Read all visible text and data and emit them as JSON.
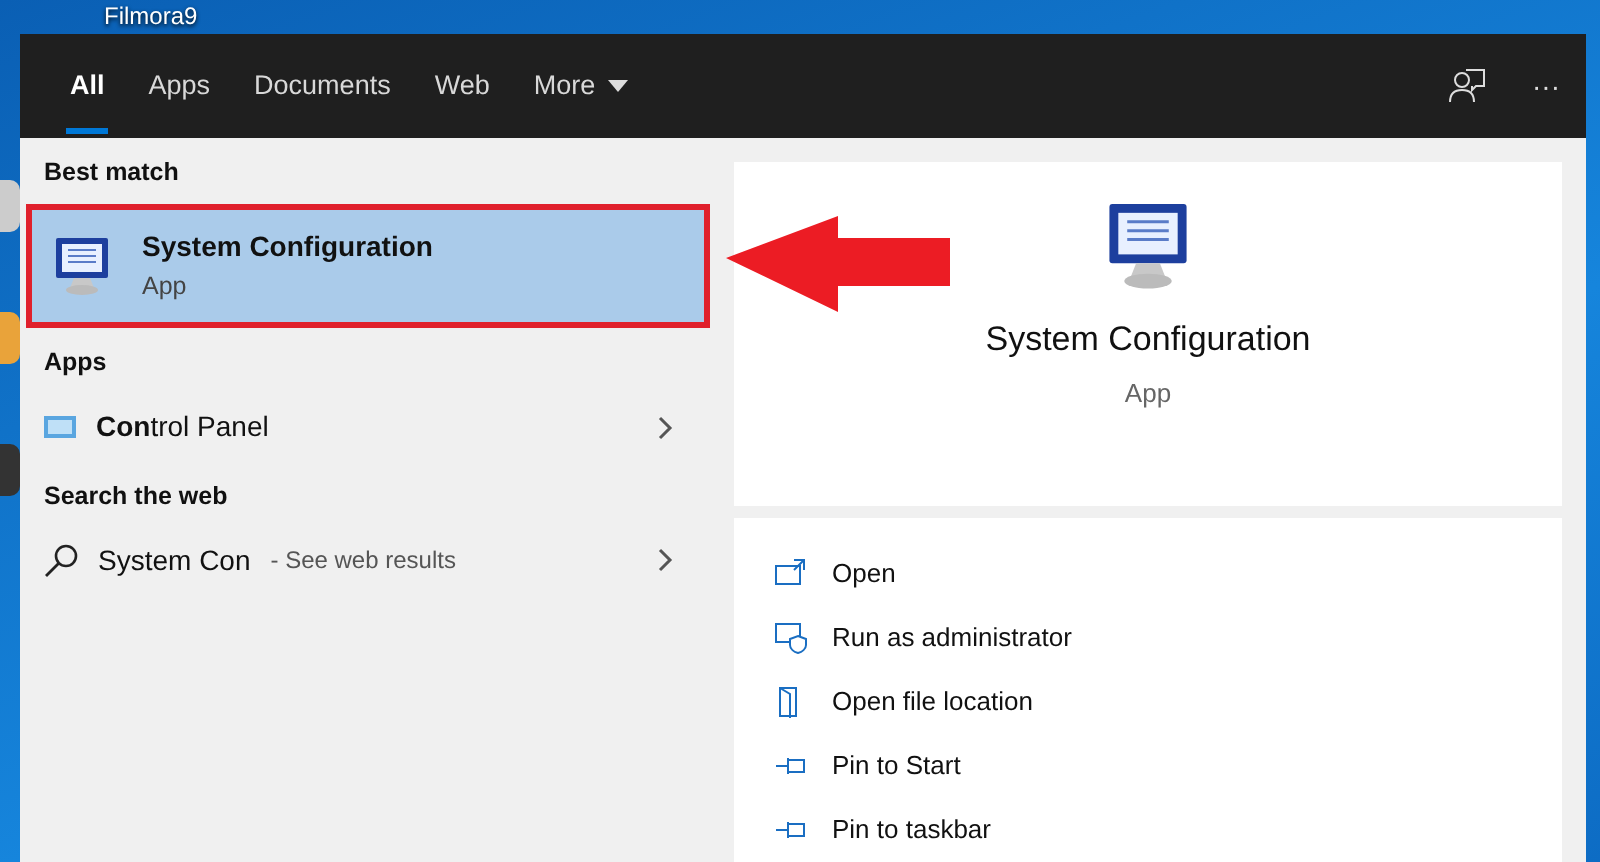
{
  "desktop": {
    "icon_label": "Filmora9"
  },
  "tabs": [
    {
      "label": "All",
      "selected": true
    },
    {
      "label": "Apps",
      "selected": false
    },
    {
      "label": "Documents",
      "selected": false
    },
    {
      "label": "Web",
      "selected": false
    },
    {
      "label": "More",
      "selected": false,
      "dropdown": true
    }
  ],
  "header_actions": [
    {
      "kind": "feedback"
    },
    {
      "kind": "more",
      "label": "···"
    }
  ],
  "sections": [
    {
      "heading": "Best match",
      "items": [
        {
          "kind": "best",
          "title": "System Configuration",
          "subtitle": "App",
          "selected": true,
          "highlighted": true
        }
      ]
    },
    {
      "heading": "Apps",
      "items": [
        {
          "kind": "app",
          "title": "**Con**trol Panel",
          "selected": false
        }
      ]
    },
    {
      "heading": "Search the web",
      "items": [
        {
          "kind": "web",
          "title": "System Con",
          "suffix": "- See web results",
          "selected": false
        }
      ]
    }
  ],
  "preview": {
    "title": "System Configuration",
    "subtitle": "App",
    "actions": [
      {
        "kind": "open",
        "label": "Open"
      },
      {
        "kind": "admin",
        "label": "Run as administrator"
      },
      {
        "kind": "folder",
        "label": "Open file location"
      },
      {
        "kind": "pin",
        "label": "Pin to Start"
      },
      {
        "kind": "pin",
        "label": "Pin to taskbar"
      }
    ]
  }
}
